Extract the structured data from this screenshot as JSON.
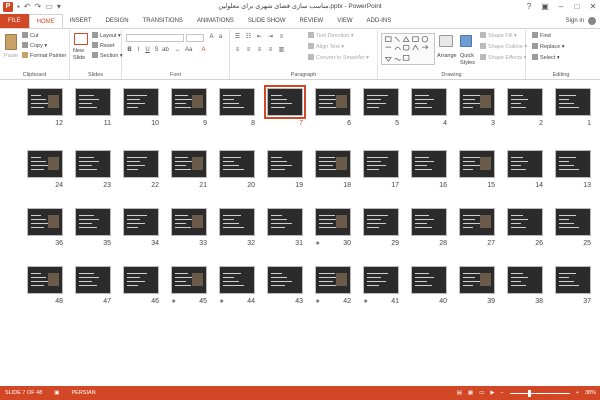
{
  "app": {
    "logo": "P",
    "title": "مناسب سازی فضای شهری برای معلولین.pptx - PowerPoint",
    "help_icon": "?",
    "sign_in": "Sign in"
  },
  "tabs": [
    "FILE",
    "HOME",
    "INSERT",
    "DESIGN",
    "TRANSITIONS",
    "ANIMATIONS",
    "SLIDE SHOW",
    "REVIEW",
    "VIEW",
    "ADD-INS"
  ],
  "active_tab": "HOME",
  "ribbon": {
    "clipboard": {
      "paste": "Paste",
      "cut": "Cut",
      "copy": "Copy",
      "format_painter": "Format Painter",
      "label": "Clipboard"
    },
    "slides": {
      "new_slide": "New",
      "new_slide2": "Slide",
      "layout": "Layout",
      "reset": "Reset",
      "section": "Section",
      "label": "Slides"
    },
    "font": {
      "label": "Font"
    },
    "paragraph": {
      "text_direction": "Text Direction",
      "align_text": "Align Text",
      "convert": "Convert to SmartArt",
      "label": "Paragraph"
    },
    "drawing": {
      "arrange": "Arrange",
      "quick_styles": "Quick",
      "quick_styles2": "Styles",
      "shape_fill": "Shape Fill",
      "shape_outline": "Shape Outline",
      "shape_effects": "Shape Effects",
      "label": "Drawing"
    },
    "editing": {
      "find": "Find",
      "replace": "Replace",
      "select": "Select",
      "label": "Editing"
    }
  },
  "slides": {
    "total": 48,
    "selected": 7,
    "rows": [
      [
        12,
        11,
        10,
        9,
        8,
        7,
        6,
        5,
        4,
        3,
        2,
        1
      ],
      [
        24,
        23,
        22,
        21,
        20,
        19,
        18,
        17,
        16,
        15,
        14,
        13
      ],
      [
        36,
        35,
        34,
        33,
        32,
        31,
        30,
        29,
        28,
        27,
        26,
        25
      ],
      [
        48,
        47,
        46,
        45,
        44,
        43,
        42,
        41,
        40,
        39,
        38,
        37
      ]
    ],
    "starred": [
      30,
      41,
      42,
      44,
      45
    ]
  },
  "status": {
    "slide_info": "SLIDE 7 OF 48",
    "language": "PERSIAN",
    "zoom": "38%",
    "zoom_minus": "−",
    "zoom_plus": "+"
  },
  "colors": {
    "accent": "#d24726"
  }
}
